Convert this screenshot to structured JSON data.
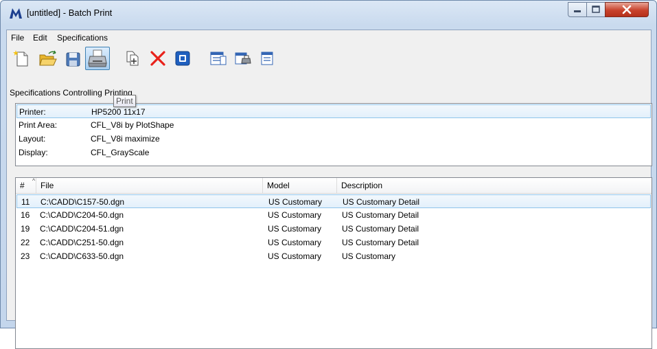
{
  "window": {
    "title": "[untitled] - Batch Print",
    "icon": "microstation-icon"
  },
  "menu": {
    "items": [
      "File",
      "Edit",
      "Specifications"
    ]
  },
  "toolbar": {
    "buttons": [
      "new-icon",
      "open-icon",
      "save-icon",
      "print-icon",
      "add-files-icon",
      "delete-icon",
      "toggle-icon",
      "specifications-icon",
      "print-setup-icon",
      "sort-list-icon"
    ],
    "active": "print-icon",
    "tooltip": "Print"
  },
  "spec": {
    "label": "Specifications Controlling Printing",
    "rows": [
      {
        "key": "Printer:",
        "value": "HP5200 11x17"
      },
      {
        "key": "Print Area:",
        "value": "CFL_V8i by PlotShape"
      },
      {
        "key": "Layout:",
        "value": "CFL_V8i maximize"
      },
      {
        "key": "Display:",
        "value": "CFL_GrayScale"
      }
    ]
  },
  "files": {
    "columns": [
      "#",
      "File",
      "Model",
      "Description"
    ],
    "rows": [
      {
        "num": "11",
        "file": "C:\\CADD\\C157-50.dgn",
        "model": "US Customary",
        "description": "US Customary Detail"
      },
      {
        "num": "16",
        "file": "C:\\CADD\\C204-50.dgn",
        "model": "US Customary",
        "description": "US Customary Detail"
      },
      {
        "num": "19",
        "file": "C:\\CADD\\C204-51.dgn",
        "model": "US Customary",
        "description": "US Customary Detail"
      },
      {
        "num": "22",
        "file": "C:\\CADD\\C251-50.dgn",
        "model": "US Customary",
        "description": "US Customary Detail"
      },
      {
        "num": "23",
        "file": "C:\\CADD\\C633-50.dgn",
        "model": "US Customary",
        "description": "US Customary"
      }
    ]
  },
  "colors": {
    "selection": "#e3f0fb",
    "delete": "#e8211a",
    "accent": "#1f5fbf"
  }
}
